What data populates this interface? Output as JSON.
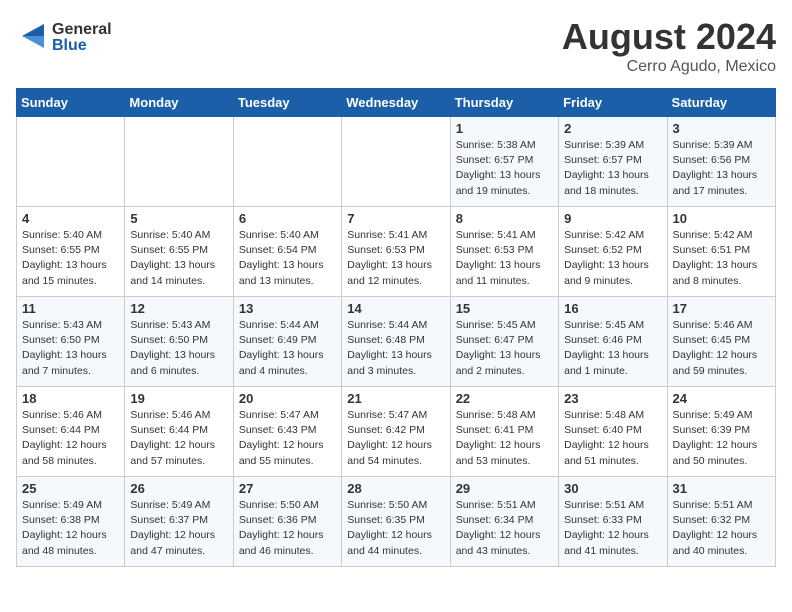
{
  "header": {
    "logo_general": "General",
    "logo_blue": "Blue",
    "main_title": "August 2024",
    "subtitle": "Cerro Agudo, Mexico"
  },
  "weekdays": [
    "Sunday",
    "Monday",
    "Tuesday",
    "Wednesday",
    "Thursday",
    "Friday",
    "Saturday"
  ],
  "weeks": [
    [
      {
        "day": "",
        "info": ""
      },
      {
        "day": "",
        "info": ""
      },
      {
        "day": "",
        "info": ""
      },
      {
        "day": "",
        "info": ""
      },
      {
        "day": "1",
        "info": "Sunrise: 5:38 AM\nSunset: 6:57 PM\nDaylight: 13 hours\nand 19 minutes."
      },
      {
        "day": "2",
        "info": "Sunrise: 5:39 AM\nSunset: 6:57 PM\nDaylight: 13 hours\nand 18 minutes."
      },
      {
        "day": "3",
        "info": "Sunrise: 5:39 AM\nSunset: 6:56 PM\nDaylight: 13 hours\nand 17 minutes."
      }
    ],
    [
      {
        "day": "4",
        "info": "Sunrise: 5:40 AM\nSunset: 6:55 PM\nDaylight: 13 hours\nand 15 minutes."
      },
      {
        "day": "5",
        "info": "Sunrise: 5:40 AM\nSunset: 6:55 PM\nDaylight: 13 hours\nand 14 minutes."
      },
      {
        "day": "6",
        "info": "Sunrise: 5:40 AM\nSunset: 6:54 PM\nDaylight: 13 hours\nand 13 minutes."
      },
      {
        "day": "7",
        "info": "Sunrise: 5:41 AM\nSunset: 6:53 PM\nDaylight: 13 hours\nand 12 minutes."
      },
      {
        "day": "8",
        "info": "Sunrise: 5:41 AM\nSunset: 6:53 PM\nDaylight: 13 hours\nand 11 minutes."
      },
      {
        "day": "9",
        "info": "Sunrise: 5:42 AM\nSunset: 6:52 PM\nDaylight: 13 hours\nand 9 minutes."
      },
      {
        "day": "10",
        "info": "Sunrise: 5:42 AM\nSunset: 6:51 PM\nDaylight: 13 hours\nand 8 minutes."
      }
    ],
    [
      {
        "day": "11",
        "info": "Sunrise: 5:43 AM\nSunset: 6:50 PM\nDaylight: 13 hours\nand 7 minutes."
      },
      {
        "day": "12",
        "info": "Sunrise: 5:43 AM\nSunset: 6:50 PM\nDaylight: 13 hours\nand 6 minutes."
      },
      {
        "day": "13",
        "info": "Sunrise: 5:44 AM\nSunset: 6:49 PM\nDaylight: 13 hours\nand 4 minutes."
      },
      {
        "day": "14",
        "info": "Sunrise: 5:44 AM\nSunset: 6:48 PM\nDaylight: 13 hours\nand 3 minutes."
      },
      {
        "day": "15",
        "info": "Sunrise: 5:45 AM\nSunset: 6:47 PM\nDaylight: 13 hours\nand 2 minutes."
      },
      {
        "day": "16",
        "info": "Sunrise: 5:45 AM\nSunset: 6:46 PM\nDaylight: 13 hours\nand 1 minute."
      },
      {
        "day": "17",
        "info": "Sunrise: 5:46 AM\nSunset: 6:45 PM\nDaylight: 12 hours\nand 59 minutes."
      }
    ],
    [
      {
        "day": "18",
        "info": "Sunrise: 5:46 AM\nSunset: 6:44 PM\nDaylight: 12 hours\nand 58 minutes."
      },
      {
        "day": "19",
        "info": "Sunrise: 5:46 AM\nSunset: 6:44 PM\nDaylight: 12 hours\nand 57 minutes."
      },
      {
        "day": "20",
        "info": "Sunrise: 5:47 AM\nSunset: 6:43 PM\nDaylight: 12 hours\nand 55 minutes."
      },
      {
        "day": "21",
        "info": "Sunrise: 5:47 AM\nSunset: 6:42 PM\nDaylight: 12 hours\nand 54 minutes."
      },
      {
        "day": "22",
        "info": "Sunrise: 5:48 AM\nSunset: 6:41 PM\nDaylight: 12 hours\nand 53 minutes."
      },
      {
        "day": "23",
        "info": "Sunrise: 5:48 AM\nSunset: 6:40 PM\nDaylight: 12 hours\nand 51 minutes."
      },
      {
        "day": "24",
        "info": "Sunrise: 5:49 AM\nSunset: 6:39 PM\nDaylight: 12 hours\nand 50 minutes."
      }
    ],
    [
      {
        "day": "25",
        "info": "Sunrise: 5:49 AM\nSunset: 6:38 PM\nDaylight: 12 hours\nand 48 minutes."
      },
      {
        "day": "26",
        "info": "Sunrise: 5:49 AM\nSunset: 6:37 PM\nDaylight: 12 hours\nand 47 minutes."
      },
      {
        "day": "27",
        "info": "Sunrise: 5:50 AM\nSunset: 6:36 PM\nDaylight: 12 hours\nand 46 minutes."
      },
      {
        "day": "28",
        "info": "Sunrise: 5:50 AM\nSunset: 6:35 PM\nDaylight: 12 hours\nand 44 minutes."
      },
      {
        "day": "29",
        "info": "Sunrise: 5:51 AM\nSunset: 6:34 PM\nDaylight: 12 hours\nand 43 minutes."
      },
      {
        "day": "30",
        "info": "Sunrise: 5:51 AM\nSunset: 6:33 PM\nDaylight: 12 hours\nand 41 minutes."
      },
      {
        "day": "31",
        "info": "Sunrise: 5:51 AM\nSunset: 6:32 PM\nDaylight: 12 hours\nand 40 minutes."
      }
    ]
  ]
}
